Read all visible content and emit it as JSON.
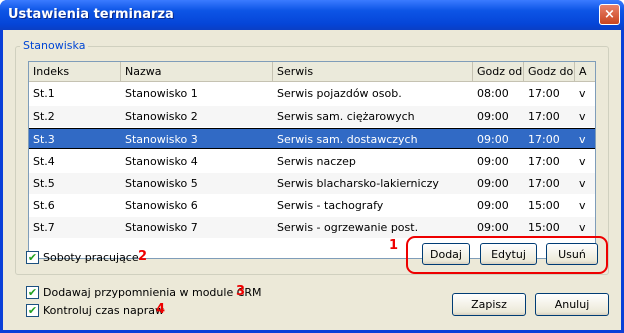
{
  "window": {
    "title": "Ustawienia terminarza",
    "close_glyph": "×"
  },
  "group": {
    "label": "Stanowiska"
  },
  "table": {
    "columns": [
      "Indeks",
      "Nazwa",
      "Serwis",
      "Godz od",
      "Godz do",
      "A"
    ],
    "rows": [
      [
        "St.1",
        "Stanowisko 1",
        "Serwis pojazdów osob.",
        "08:00",
        "17:00",
        "v"
      ],
      [
        "St.2",
        "Stanowisko 2",
        "Serwis sam. ciężarowych",
        "09:00",
        "17:00",
        "v"
      ],
      [
        "St.3",
        "Stanowisko 3",
        "Serwis sam. dostawczych",
        "09:00",
        "17:00",
        "v"
      ],
      [
        "St.4",
        "Stanowisko 4",
        "Serwis naczep",
        "09:00",
        "17:00",
        "v"
      ],
      [
        "St.5",
        "Stanowisko 5",
        "Serwis blacharsko-lakierniczy",
        "09:00",
        "17:00",
        "v"
      ],
      [
        "St.6",
        "Stanowisko 6",
        "Serwis - tachografy",
        "09:00",
        "15:00",
        "v"
      ],
      [
        "St.7",
        "Stanowisko 7",
        "Serwis - ogrzewanie post.",
        "09:00",
        "15:00",
        "v"
      ]
    ],
    "selected_index": 2
  },
  "options": {
    "saturdays": {
      "label": "Soboty pracujące",
      "checked": true,
      "marker": "2"
    },
    "reminders": {
      "label": "Dodawaj przypomnienia w module CRM",
      "checked": true,
      "marker": "3"
    },
    "repair_time": {
      "label": "Kontroluj czas napraw",
      "checked": true,
      "marker": "4"
    }
  },
  "buttons": {
    "marker": "1",
    "add": "Dodaj",
    "edit": "Edytuj",
    "delete": "Usuń",
    "save": "Zapisz",
    "cancel": "Anuluj"
  },
  "check_glyph": "✔",
  "colors": {
    "selection": "#316ac5",
    "title_bar": "#0545d8",
    "annotation": "#ee0000"
  }
}
